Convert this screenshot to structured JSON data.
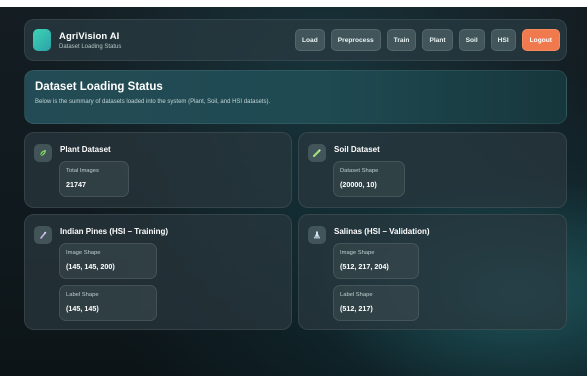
{
  "app": {
    "name": "AgriVision AI",
    "subtitle": "Dataset Loading Status"
  },
  "nav": {
    "items": [
      "Load",
      "Preprocess",
      "Train",
      "Plant",
      "Soil",
      "HSI"
    ],
    "logout": "Logout"
  },
  "status": {
    "title": "Dataset Loading Status",
    "description": "Below is the summary of datasets loaded into the system (Plant, Soil, and HSI datasets)."
  },
  "cards": {
    "plant": {
      "title": "Plant Dataset",
      "icon": "leaf-icon",
      "stats": [
        {
          "label": "Total Images",
          "value": "21747"
        }
      ]
    },
    "soil": {
      "title": "Soil Dataset",
      "icon": "soil-test-icon",
      "stats": [
        {
          "label": "Dataset Shape",
          "value": "(20000, 10)"
        }
      ]
    },
    "indian_pines": {
      "title": "Indian Pines (HSI – Training)",
      "icon": "pine-brush-icon",
      "stats": [
        {
          "label": "Image Shape",
          "value": "(145, 145, 200)"
        },
        {
          "label": "Label Shape",
          "value": "(145, 145)"
        }
      ]
    },
    "salinas": {
      "title": "Salinas (HSI – Validation)",
      "icon": "flask-icon",
      "stats": [
        {
          "label": "Image Shape",
          "value": "(512, 217, 204)"
        },
        {
          "label": "Label Shape",
          "value": "(512, 217)"
        }
      ]
    }
  },
  "colors": {
    "accent": "#f07a4e",
    "logo": "#3fd3b6",
    "background": "#111b1f"
  }
}
